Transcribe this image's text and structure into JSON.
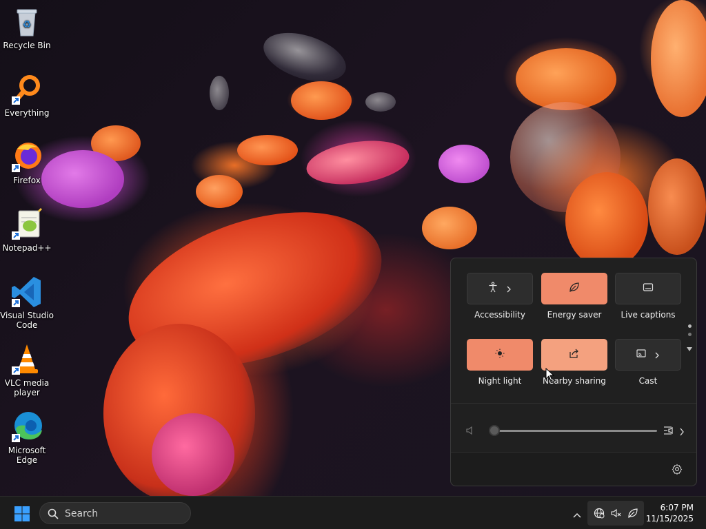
{
  "desktop": {
    "icons": [
      {
        "label": "Recycle Bin"
      },
      {
        "label": "Everything"
      },
      {
        "label": "Firefox"
      },
      {
        "label": "Notepad++"
      },
      {
        "label": "Visual Studio Code"
      },
      {
        "label": "VLC media player"
      },
      {
        "label": "Microsoft Edge"
      }
    ]
  },
  "quick_settings": {
    "tiles": [
      {
        "label": "Accessibility",
        "icon": "accessibility-icon",
        "active": false,
        "has_arrow": true
      },
      {
        "label": "Energy saver",
        "icon": "leaf-icon",
        "active": true,
        "has_arrow": false
      },
      {
        "label": "Live captions",
        "icon": "captions-icon",
        "active": false,
        "has_arrow": false
      },
      {
        "label": "Night light",
        "icon": "night-light-icon",
        "active": true,
        "has_arrow": false
      },
      {
        "label": "Nearby sharing",
        "icon": "share-icon",
        "active": true,
        "has_arrow": false
      },
      {
        "label": "Cast",
        "icon": "cast-icon",
        "active": false,
        "has_arrow": true
      }
    ],
    "volume": {
      "level": 0,
      "icon": "speaker-muted-icon"
    },
    "page_indicator": {
      "pages": 2,
      "current": 1
    }
  },
  "taskbar": {
    "search_placeholder": "Search",
    "clock": {
      "time": "6:07 PM",
      "date": "11/15/2025"
    }
  },
  "colors": {
    "accent_active": "#f08a6a",
    "accent_active_alt": "#f4a17f",
    "panel_bg": "#202020",
    "taskbar_bg": "#1c1c1c"
  }
}
